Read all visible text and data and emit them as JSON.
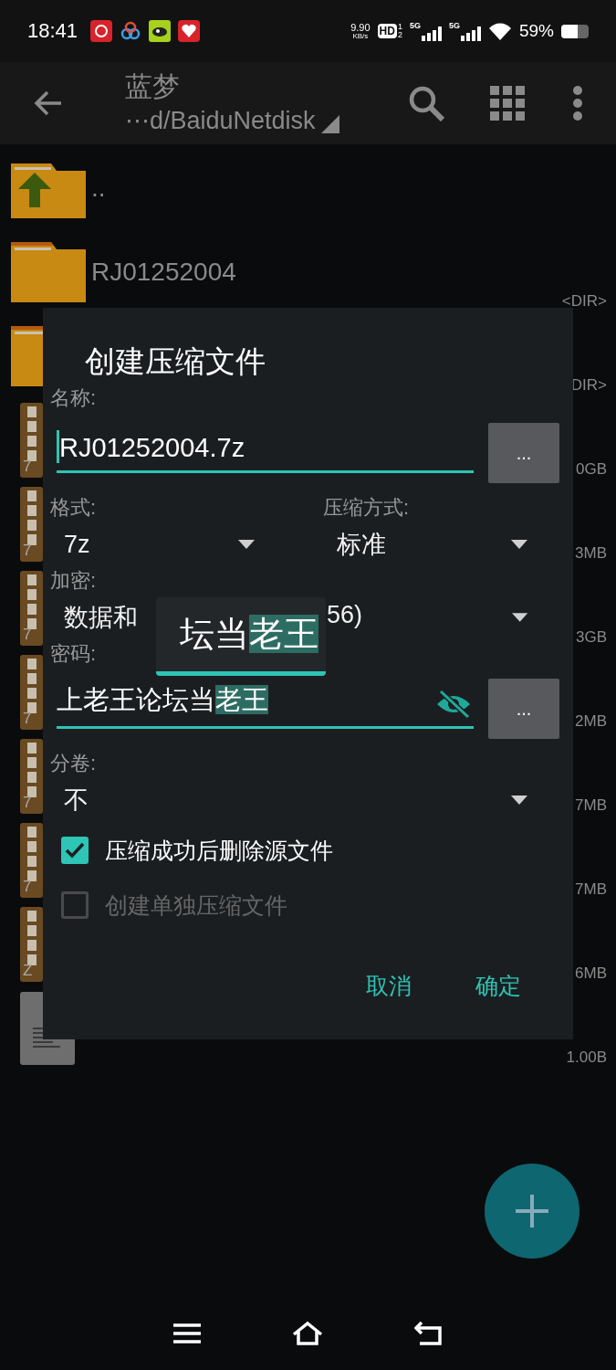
{
  "status_bar": {
    "time": "18:41",
    "net_speed": "9.90",
    "net_speed_unit": "KB/s",
    "hd_label": "HD",
    "hd_slots": [
      "1",
      "2"
    ],
    "signals": [
      {
        "label": "5G"
      },
      {
        "label": "5G"
      }
    ],
    "battery": "59%"
  },
  "toolbar": {
    "title": "蓝梦",
    "path": "⋯d/BaiduNetdisk"
  },
  "files": [
    {
      "kind": "up",
      "name": ".."
    },
    {
      "kind": "folder",
      "name": "RJ01252004",
      "size": "<DIR>"
    },
    {
      "kind": "folder",
      "size": "DIR>"
    },
    {
      "kind": "archive",
      "icon_letter": "7",
      "size": "0GB"
    },
    {
      "kind": "archive",
      "icon_letter": "7",
      "size": "3MB"
    },
    {
      "kind": "archive",
      "icon_letter": "7",
      "size": "3GB"
    },
    {
      "kind": "archive",
      "icon_letter": "7",
      "size": "2MB"
    },
    {
      "kind": "archive",
      "icon_letter": "7",
      "size": "7MB"
    },
    {
      "kind": "archive",
      "icon_letter": "7",
      "size": "7MB"
    },
    {
      "kind": "archive",
      "icon_letter": "Z",
      "size": "6MB"
    },
    {
      "kind": "document",
      "size": "1.00B"
    }
  ],
  "dialog": {
    "title": "创建压缩文件",
    "name": {
      "label": "名称:",
      "value": "RJ01252004.7z",
      "more": "..."
    },
    "format": {
      "label": "格式:",
      "value": "7z"
    },
    "method": {
      "label": "压缩方式:",
      "value": "标准"
    },
    "encryption": {
      "label": "加密:",
      "value_start": "数据和",
      "value_end": "56)"
    },
    "password": {
      "label": "密码:",
      "text": "上老王论坛当",
      "selected_text": "老王",
      "show_password": true,
      "more": "..."
    },
    "magnifier": {
      "text": "坛当",
      "selected_text": "老王"
    },
    "split": {
      "label": "分卷:",
      "value": "不"
    },
    "options": [
      {
        "label": "压缩成功后删除源文件",
        "checked": true,
        "disabled": false
      },
      {
        "label": "创建单独压缩文件",
        "checked": false,
        "disabled": true
      }
    ],
    "buttons": [
      "取消",
      "确定"
    ]
  }
}
